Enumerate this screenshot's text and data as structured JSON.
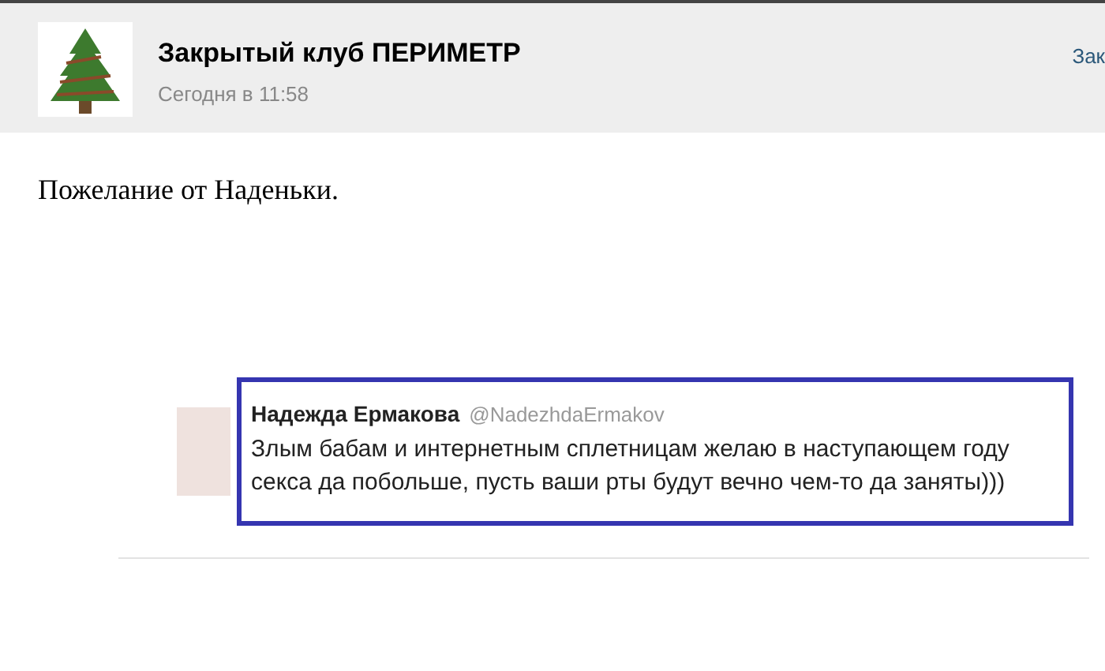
{
  "post_header": {
    "title": "Закрытый клуб ПЕРИМЕТР",
    "time": "Сегодня в 11:58",
    "action_link": "Зак"
  },
  "post_text": "Пожелание от Наденьки.",
  "tweet": {
    "name": "Надежда Ермакова",
    "handle": "@NadezhdaErmakov",
    "text": "Злым бабам и интернетным сплетницам желаю в наступающем году секса да побольше, пусть ваши рты будут вечно чем-то да заняты)))"
  }
}
